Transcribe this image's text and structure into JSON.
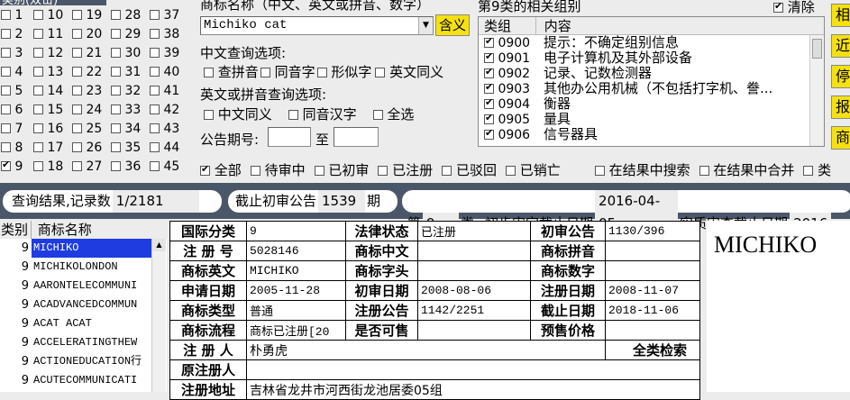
{
  "classes": {
    "header": "类别(双击)",
    "columns": [
      [
        {
          "n": "1",
          "on": false
        },
        {
          "n": "2",
          "on": false
        },
        {
          "n": "3",
          "on": false
        },
        {
          "n": "4",
          "on": false
        },
        {
          "n": "5",
          "on": false
        },
        {
          "n": "6",
          "on": false
        },
        {
          "n": "7",
          "on": false
        },
        {
          "n": "8",
          "on": false
        },
        {
          "n": "9",
          "on": true
        }
      ],
      [
        {
          "n": "10",
          "on": false
        },
        {
          "n": "11",
          "on": false
        },
        {
          "n": "12",
          "on": false
        },
        {
          "n": "13",
          "on": false
        },
        {
          "n": "14",
          "on": false
        },
        {
          "n": "15",
          "on": false
        },
        {
          "n": "16",
          "on": false
        },
        {
          "n": "17",
          "on": false
        },
        {
          "n": "18",
          "on": false
        }
      ],
      [
        {
          "n": "19",
          "on": false
        },
        {
          "n": "20",
          "on": false
        },
        {
          "n": "21",
          "on": false
        },
        {
          "n": "22",
          "on": false
        },
        {
          "n": "23",
          "on": false
        },
        {
          "n": "24",
          "on": false
        },
        {
          "n": "25",
          "on": false
        },
        {
          "n": "26",
          "on": false
        },
        {
          "n": "27",
          "on": false
        }
      ],
      [
        {
          "n": "28",
          "on": false
        },
        {
          "n": "29",
          "on": false
        },
        {
          "n": "30",
          "on": false
        },
        {
          "n": "31",
          "on": false
        },
        {
          "n": "32",
          "on": false
        },
        {
          "n": "33",
          "on": false
        },
        {
          "n": "34",
          "on": false
        },
        {
          "n": "35",
          "on": false
        },
        {
          "n": "36",
          "on": false
        }
      ],
      [
        {
          "n": "37",
          "on": false
        },
        {
          "n": "38",
          "on": false
        },
        {
          "n": "39",
          "on": false
        },
        {
          "n": "40",
          "on": false
        },
        {
          "n": "41",
          "on": false
        },
        {
          "n": "42",
          "on": false
        },
        {
          "n": "43",
          "on": false
        },
        {
          "n": "44",
          "on": false
        },
        {
          "n": "45",
          "on": false
        }
      ]
    ]
  },
  "query": {
    "label": "商标名称（中文、英文或拼音、数字）",
    "value": "Michiko cat",
    "meaning_btn": "含义",
    "cn_options_label": "中文查询选项:",
    "cn_options": [
      "查拼音",
      "同音字",
      "形似字",
      "英文同义"
    ],
    "en_options_label": "英文或拼音查询选项:",
    "en_options": [
      "中文同义",
      "同音汉字",
      "全选"
    ],
    "period_label": "公告期号:",
    "period_to": "至"
  },
  "groups": {
    "title": "第9类的相关组别",
    "clear_label": "清除",
    "col_group": "类组",
    "col_content": "内容",
    "rows": [
      {
        "code": "0900",
        "text": "提示：不确定组别信息"
      },
      {
        "code": "0901",
        "text": "电子计算机及其外部设备"
      },
      {
        "code": "0902",
        "text": "记录、记数检测器"
      },
      {
        "code": "0903",
        "text": "其他办公用机械（不包括打字机、誊..."
      },
      {
        "code": "0904",
        "text": "衡器"
      },
      {
        "code": "0905",
        "text": "量具"
      },
      {
        "code": "0906",
        "text": "信号器具"
      }
    ]
  },
  "side_buttons": [
    "相",
    "近",
    "停",
    "报",
    "商"
  ],
  "status_filters": [
    {
      "label": "全部",
      "on": true
    },
    {
      "label": "待审中",
      "on": false
    },
    {
      "label": "已初审",
      "on": false
    },
    {
      "label": "已注册",
      "on": false
    },
    {
      "label": "已驳回",
      "on": false
    },
    {
      "label": "已销亡",
      "on": false
    },
    {
      "label": "在结果中搜索",
      "on": false
    },
    {
      "label": "在结果中合并",
      "on": false
    },
    {
      "label": "类",
      "on": false
    }
  ],
  "info_bar": {
    "result_label": "查询结果,记录数",
    "result_value": "1/2181",
    "cutoff_label": "截止初审公告",
    "cutoff_value": "1539",
    "cutoff_unit": "期",
    "class_prefix": "第",
    "class_value": "9",
    "class_suffix": "类",
    "prelim_label": "初步审定截止日期",
    "prelim_value": "2016-04-05",
    "substantive_label": "实质审查截止日期",
    "substantive_value": "2016"
  },
  "results": {
    "col_class": "类别",
    "col_name": "商标名称",
    "rows": [
      {
        "cls": "9",
        "name": "MICHIKO"
      },
      {
        "cls": "9",
        "name": "MICHIKOLONDON"
      },
      {
        "cls": "9",
        "name": "AARONTELECOMMUNI"
      },
      {
        "cls": "9",
        "name": "ACADVANCEDCOMMUN"
      },
      {
        "cls": "9",
        "name": "ACAT ACAT"
      },
      {
        "cls": "9",
        "name": "ACCELERATINGTHEW"
      },
      {
        "cls": "9",
        "name": "ACTIONEDUCATION行"
      },
      {
        "cls": "9",
        "name": "ACUTECOMMUNICATI"
      }
    ]
  },
  "detail": {
    "intl_class_label": "国际分类",
    "intl_class": "9",
    "legal_status_label": "法律状态",
    "legal_status": "已注册",
    "prelim_pub_label": "初审公告",
    "prelim_pub": "1130/396",
    "reg_no_label": "注 册 号",
    "reg_no": "5028146",
    "cn_name_label": "商标中文",
    "cn_name": "",
    "pinyin_label": "商标拼音",
    "pinyin": "",
    "en_name_label": "商标英文",
    "en_name": "MICHIKO",
    "head_label": "商标字头",
    "head": "",
    "digits_label": "商标数字",
    "digits": "",
    "apply_date_label": "申请日期",
    "apply_date": "2005-11-28",
    "prelim_date_label": "初审日期",
    "prelim_date": "2008-08-06",
    "reg_date_label": "注册日期",
    "reg_date": "2008-11-07",
    "type_label": "商标类型",
    "type": "普通",
    "reg_pub_label": "注册公告",
    "reg_pub": "1142/2251",
    "expiry_label": "截止日期",
    "expiry": "2018-11-06",
    "flow_label": "商标流程",
    "flow": "商标已注册[20",
    "saleable_label": "是否可售",
    "saleable": "",
    "price_label": "预售价格",
    "price": "",
    "registrant_label": "注 册 人",
    "registrant": "朴勇虎",
    "full_search_label": "全类检索",
    "orig_registrant_label": "原注册人",
    "orig_registrant": "",
    "address_label": "注册地址",
    "address": "吉林省龙井市河西街龙池居委05组"
  },
  "preview_text": "MICHIKO"
}
